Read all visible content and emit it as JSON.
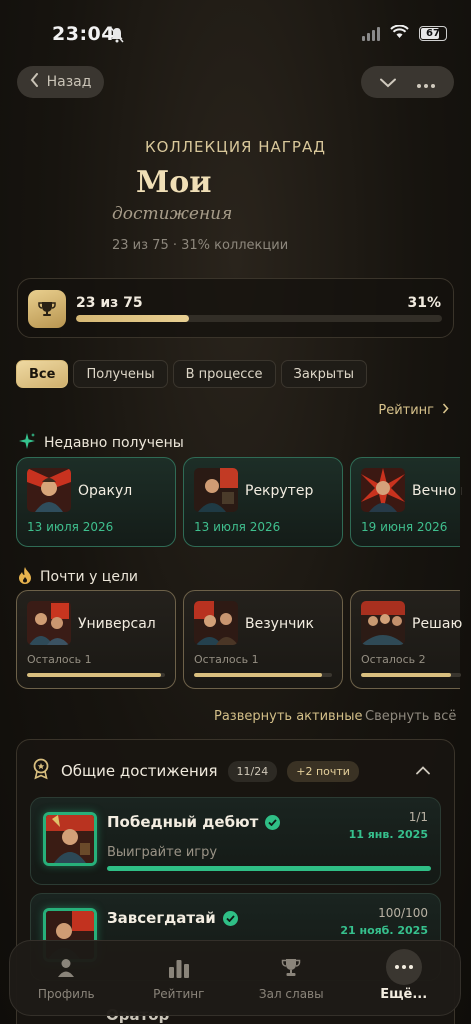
{
  "status_bar": {
    "time": "23:04",
    "battery": "67"
  },
  "nav": {
    "back_label": "Назад"
  },
  "header": {
    "kicker": "КОЛЛЕКЦИЯ НАГРАД",
    "title_main": "Мои",
    "title_sub": "достижения",
    "subtitle": "23 из 75 · 31% коллекции"
  },
  "progress": {
    "count_label": "23 из 75",
    "percent_label": "31%",
    "fraction": 0.31
  },
  "filters": [
    "Все",
    "Получены",
    "В процессе",
    "Закрыты"
  ],
  "rating_link": "Рейтинг",
  "recent": {
    "title": "Недавно получены",
    "items": [
      {
        "name": "Оракул",
        "date": "13 июля 2026"
      },
      {
        "name": "Рекрутер",
        "date": "13 июля 2026"
      },
      {
        "name": "Вечно в",
        "date": "19 июня 2026"
      }
    ]
  },
  "almost": {
    "title": "Почти у цели",
    "items": [
      {
        "name": "Универсал",
        "remaining": "Осталось 1",
        "progress": 0.97
      },
      {
        "name": "Везунчик",
        "remaining": "Осталось 1",
        "progress": 0.93
      },
      {
        "name": "Решаю",
        "remaining": "Осталось 2",
        "progress": 0.9
      }
    ]
  },
  "actions": {
    "expand": "Развернуть активные",
    "collapse": "Свернуть всё"
  },
  "general": {
    "title": "Общие достижения",
    "count": "11/24",
    "almost_badge": "+2 почти",
    "items": [
      {
        "name": "Победный дебют",
        "progress": "1/1",
        "date": "11 янв. 2025",
        "desc": "Выиграйте игру",
        "fraction": 1.0
      },
      {
        "name": "Завсегдатай",
        "progress": "100/100",
        "date": "21 нояб. 2025",
        "desc": "",
        "fraction": 1.0
      }
    ],
    "peek_label": "Оратор"
  },
  "tabbar": {
    "profile": "Профиль",
    "rating": "Рейтинг",
    "hall": "Зал славы",
    "more": "Ещё..."
  }
}
